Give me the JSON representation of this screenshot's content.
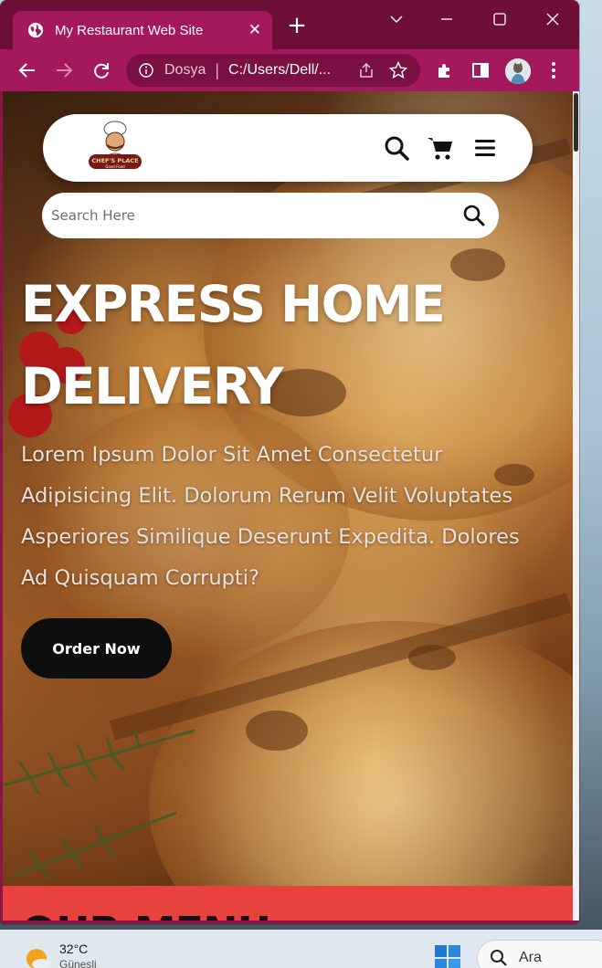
{
  "browser": {
    "tab_title": "My Restaurant Web Site",
    "address_scheme": "Dosya",
    "address_url": "C:/Users/Dell/...",
    "accent_color": "#a3195b"
  },
  "site": {
    "logo_text": "CHEF'S PLACE",
    "logo_subtext": "Good Food",
    "search_placeholder": "Search Here",
    "hero": {
      "headline": "EXPRESS HOME DELIVERY",
      "lead": "Lorem Ipsum Dolor Sit Amet Consectetur Adipisicing Elit. Dolorum Rerum Velit Voluptates Asperiores Similique Deserunt Expedita. Dolores Ad Quisquam Corrupti?",
      "cta_label": "Order Now"
    },
    "menu_section_title": "OUR MENU",
    "menu_section_color": "#e8423f"
  },
  "taskbar": {
    "temperature": "32°C",
    "condition": "Güneşli",
    "search_label": "Ara"
  },
  "icons": [
    "globe-icon",
    "close-icon",
    "plus-icon",
    "chevron-down-icon",
    "minimize-icon",
    "maximize-icon",
    "back-arrow-icon",
    "forward-arrow-icon",
    "reload-icon",
    "info-icon",
    "share-icon",
    "star-icon",
    "extensions-icon",
    "side-panel-icon",
    "profile-avatar",
    "more-menu-icon",
    "search-icon",
    "cart-icon",
    "hamburger-menu-icon",
    "weather-sun-icon",
    "windows-start-icon"
  ]
}
